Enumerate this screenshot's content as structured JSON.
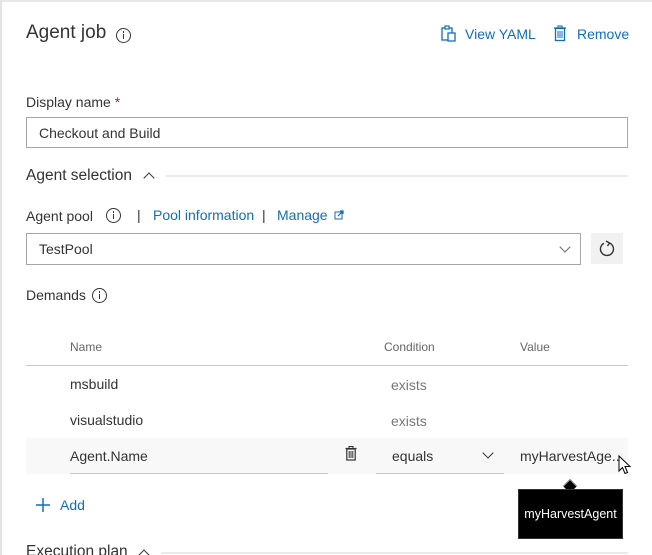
{
  "header": {
    "title": "Agent job",
    "view_yaml_label": "View YAML",
    "remove_label": "Remove"
  },
  "display_name": {
    "label": "Display name",
    "required_marker": "*",
    "value": "Checkout and Build"
  },
  "agent_selection": {
    "section_title": "Agent selection",
    "agent_pool_label": "Agent pool",
    "separator": "|",
    "pool_information_label": "Pool information",
    "manage_label": "Manage",
    "selected_pool": "TestPool"
  },
  "demands": {
    "label": "Demands",
    "columns": {
      "name": "Name",
      "condition": "Condition",
      "value": "Value"
    },
    "rows": [
      {
        "name": "msbuild",
        "condition": "exists",
        "value": ""
      },
      {
        "name": "visualstudio",
        "condition": "exists",
        "value": ""
      },
      {
        "name": "Agent.Name",
        "condition": "equals",
        "value": "myHarvestAge..."
      }
    ],
    "add_label": "Add",
    "tooltip": "myHarvestAgent"
  },
  "execution_plan": {
    "section_title": "Execution plan"
  },
  "colors": {
    "link": "#106ebe",
    "required": "#a4262c",
    "tooltip_bg": "#000000"
  }
}
